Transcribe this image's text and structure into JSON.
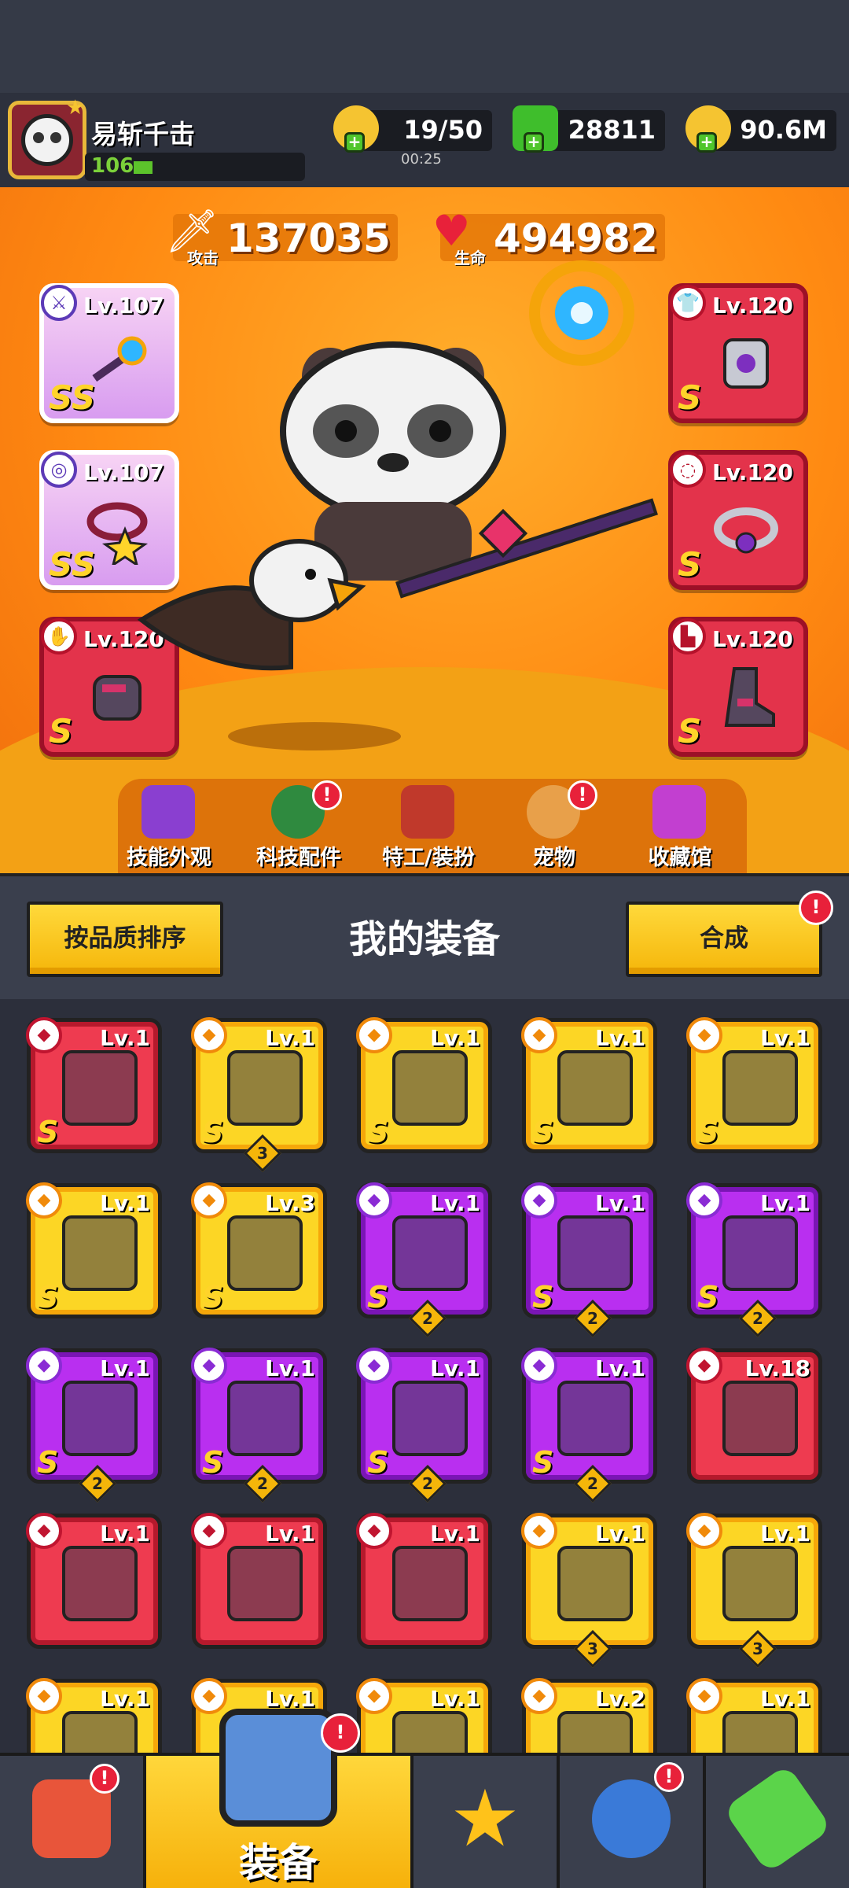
{
  "player": {
    "name": "易斩千击",
    "level": "106"
  },
  "resources": {
    "stamina": {
      "value": "19/50",
      "timer": "00:25",
      "icon": "lightning-icon"
    },
    "gems": {
      "value": "28811",
      "icon": "gem-icon"
    },
    "coins": {
      "value": "90.6M",
      "icon": "coin-icon"
    }
  },
  "stats": {
    "attack": {
      "label": "攻击",
      "value": "137035",
      "icon": "sword-icon"
    },
    "hp": {
      "label": "生命",
      "value": "494982",
      "icon": "heart-icon"
    }
  },
  "equipped": {
    "left": [
      {
        "lv": "Lv.107",
        "grade": "SS",
        "type": "weapon-icon",
        "style": "pink"
      },
      {
        "lv": "Lv.107",
        "grade": "SS",
        "type": "necklace-icon",
        "style": "pink"
      },
      {
        "lv": "Lv.120",
        "grade": "S",
        "type": "glove-icon",
        "style": "red"
      }
    ],
    "right": [
      {
        "lv": "Lv.120",
        "grade": "S",
        "type": "armor-icon",
        "style": "red"
      },
      {
        "lv": "Lv.120",
        "grade": "S",
        "type": "belt-icon",
        "style": "red"
      },
      {
        "lv": "Lv.120",
        "grade": "S",
        "type": "boots-icon",
        "style": "red"
      }
    ]
  },
  "features": [
    {
      "label": "技能外观",
      "icon": "skill-skin-icon",
      "badge": false
    },
    {
      "label": "科技配件",
      "icon": "tech-part-icon",
      "badge": true
    },
    {
      "label": "特工/装扮",
      "icon": "agent-icon",
      "badge": false
    },
    {
      "label": "宠物",
      "icon": "pet-icon",
      "badge": true
    },
    {
      "label": "收藏馆",
      "icon": "collection-icon",
      "badge": false
    }
  ],
  "equipment_panel": {
    "title": "我的装备",
    "sort_label": "按品质排序",
    "merge_label": "合成",
    "badge": "!"
  },
  "inventory": [
    {
      "lv": "Lv.1",
      "grade": "S",
      "color": "red",
      "count": ""
    },
    {
      "lv": "Lv.1",
      "grade": "S",
      "color": "yellow",
      "count": "3"
    },
    {
      "lv": "Lv.1",
      "grade": "S",
      "color": "yellow",
      "count": ""
    },
    {
      "lv": "Lv.1",
      "grade": "S",
      "color": "yellow",
      "count": ""
    },
    {
      "lv": "Lv.1",
      "grade": "S",
      "color": "yellow",
      "count": ""
    },
    {
      "lv": "Lv.1",
      "grade": "S",
      "color": "yellow",
      "count": ""
    },
    {
      "lv": "Lv.3",
      "grade": "S",
      "color": "yellow",
      "count": ""
    },
    {
      "lv": "Lv.1",
      "grade": "S",
      "color": "purple",
      "count": "2"
    },
    {
      "lv": "Lv.1",
      "grade": "S",
      "color": "purple",
      "count": "2"
    },
    {
      "lv": "Lv.1",
      "grade": "S",
      "color": "purple",
      "count": "2"
    },
    {
      "lv": "Lv.1",
      "grade": "S",
      "color": "purple",
      "count": "2"
    },
    {
      "lv": "Lv.1",
      "grade": "S",
      "color": "purple",
      "count": "2"
    },
    {
      "lv": "Lv.1",
      "grade": "S",
      "color": "purple",
      "count": "2"
    },
    {
      "lv": "Lv.1",
      "grade": "S",
      "color": "purple",
      "count": "2"
    },
    {
      "lv": "Lv.18",
      "grade": "",
      "color": "red",
      "count": ""
    },
    {
      "lv": "Lv.1",
      "grade": "",
      "color": "red",
      "count": ""
    },
    {
      "lv": "Lv.1",
      "grade": "",
      "color": "red",
      "count": ""
    },
    {
      "lv": "Lv.1",
      "grade": "",
      "color": "red",
      "count": ""
    },
    {
      "lv": "Lv.1",
      "grade": "",
      "color": "yellow",
      "count": "3"
    },
    {
      "lv": "Lv.1",
      "grade": "",
      "color": "yellow",
      "count": "3"
    },
    {
      "lv": "Lv.1",
      "grade": "",
      "color": "yellow",
      "count": ""
    },
    {
      "lv": "Lv.1",
      "grade": "",
      "color": "yellow",
      "count": ""
    },
    {
      "lv": "Lv.1",
      "grade": "",
      "color": "yellow",
      "count": ""
    },
    {
      "lv": "Lv.2",
      "grade": "",
      "color": "yellow",
      "count": ""
    },
    {
      "lv": "Lv.1",
      "grade": "",
      "color": "yellow",
      "count": ""
    }
  ],
  "nav": [
    {
      "label": "",
      "icon": "shop-icon",
      "badge": true,
      "active": false
    },
    {
      "label": "装备",
      "icon": "equipment-icon",
      "badge": true,
      "active": true
    },
    {
      "label": "",
      "icon": "battle-star-icon",
      "badge": false,
      "active": false
    },
    {
      "label": "",
      "icon": "world-icon",
      "badge": true,
      "active": false
    },
    {
      "label": "",
      "icon": "gene-icon",
      "badge": false,
      "active": false
    }
  ]
}
